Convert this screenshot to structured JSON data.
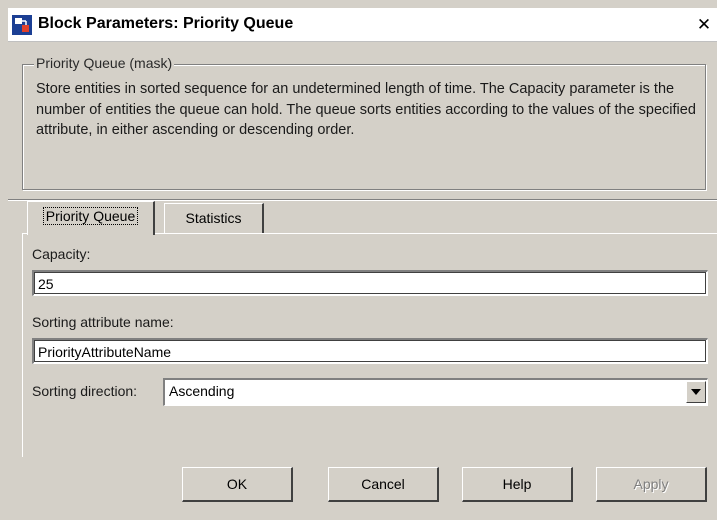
{
  "window": {
    "title": "Block Parameters: Priority Queue",
    "close_glyph": "✕",
    "title_icon": "simulink-block-icon",
    "close_icon": "close-icon"
  },
  "mask": {
    "group_label": "Priority Queue (mask)",
    "description": "Store entities in sorted sequence for an undetermined length of time. The Capacity parameter is the number of entities the queue can hold. The queue sorts entities according to the values of the specified attribute, in either ascending or descending order."
  },
  "tabs": [
    {
      "label": "Priority Queue",
      "active": true
    },
    {
      "label": "Statistics",
      "active": false
    }
  ],
  "params": {
    "capacity_label": "Capacity:",
    "capacity_value": "25",
    "sort_attr_label": "Sorting attribute name:",
    "sort_attr_value": "PriorityAttributeName",
    "sort_dir_label": "Sorting direction:",
    "sort_dir_value": "Ascending"
  },
  "buttons": {
    "ok": "OK",
    "cancel": "Cancel",
    "help": "Help",
    "apply": "Apply",
    "apply_enabled": false
  },
  "colors": {
    "face": "#d4d0c8",
    "shadow": "#808080",
    "highlight": "#ffffff"
  }
}
